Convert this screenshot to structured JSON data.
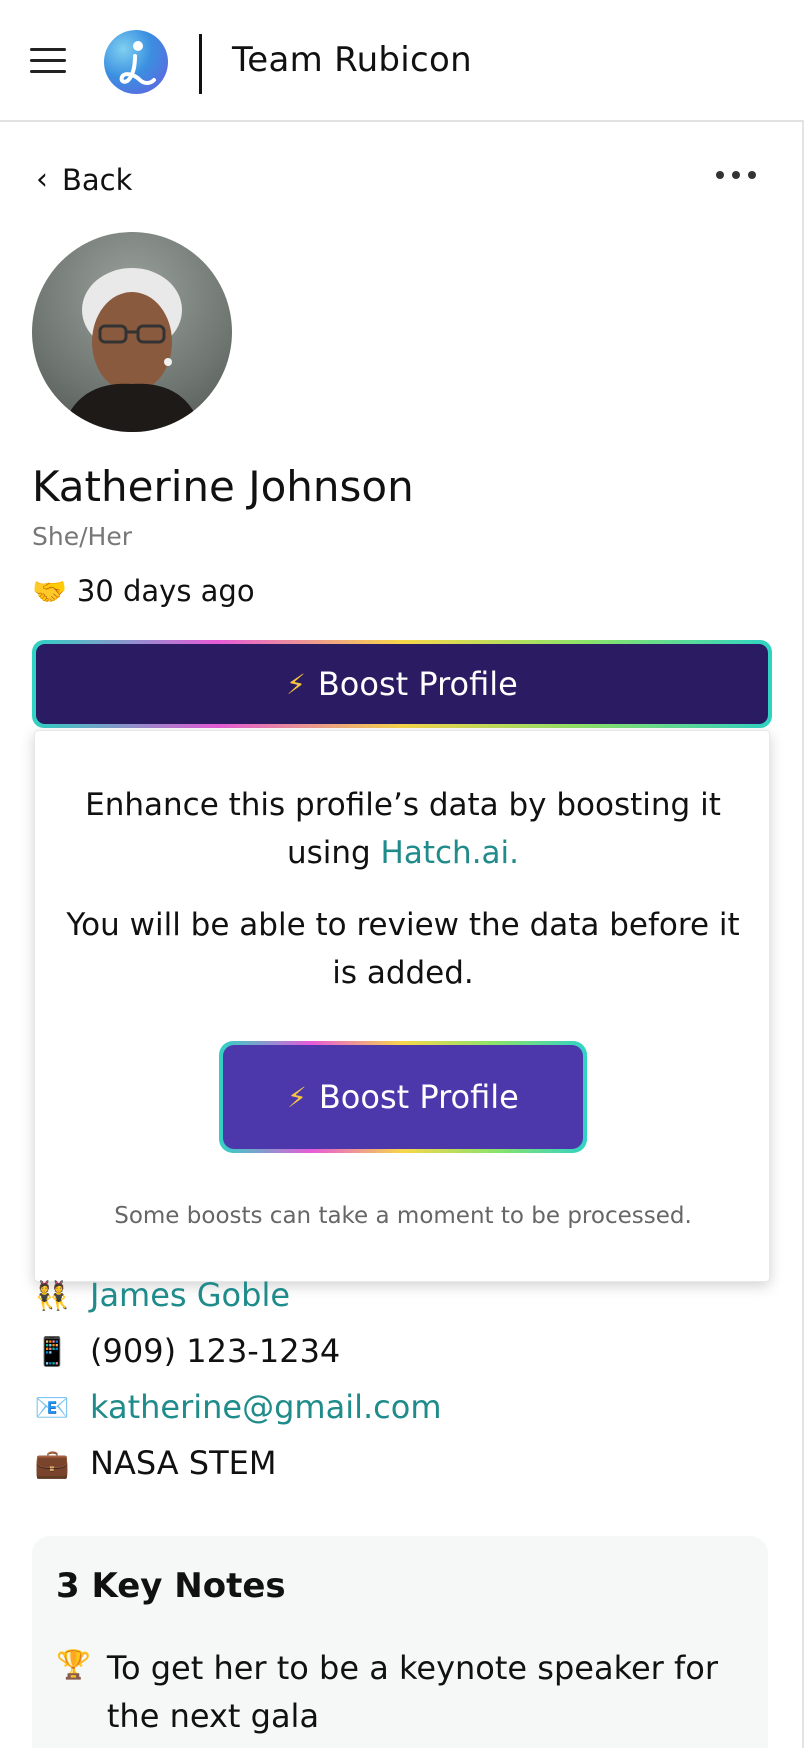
{
  "header": {
    "app_name": "Team Rubicon",
    "menu_icon": "hamburger-icon",
    "logo_icon": "app-logo"
  },
  "nav": {
    "back_label": "Back",
    "more_icon": "more-horizontal-icon"
  },
  "profile": {
    "name": "Katherine Johnson",
    "pronouns": "She/Her",
    "last_contact_emoji": "🤝",
    "last_contact": "30 days ago",
    "boost_icon": "⚡",
    "boost_label": "Boost Profile"
  },
  "popover": {
    "text_before_link": "Enhance this profile’s data by boosting it using ",
    "link_text": "Hatch.ai.",
    "review_text": "You will be able to review the data before it is added.",
    "boost_icon": "⚡",
    "boost_label": "Boost Profile",
    "note": "Some boosts can take a moment to be processed."
  },
  "details": {
    "relationship_icon": "👯",
    "relationship": "James Goble",
    "phone_icon": "📱",
    "phone": "(909) 123-1234",
    "email_icon": "📧",
    "email": "katherine@gmail.com",
    "work_icon": "💼",
    "work": "NASA STEM"
  },
  "key_notes": {
    "title": "3 Key Notes",
    "items": [
      {
        "icon": "🏆",
        "text": "To get her to be a keynote speaker for the next gala"
      }
    ]
  },
  "colors": {
    "accent_teal": "#1f8b8a",
    "boost_dark": "#2a1b63",
    "boost_purple": "#4d38ab"
  }
}
